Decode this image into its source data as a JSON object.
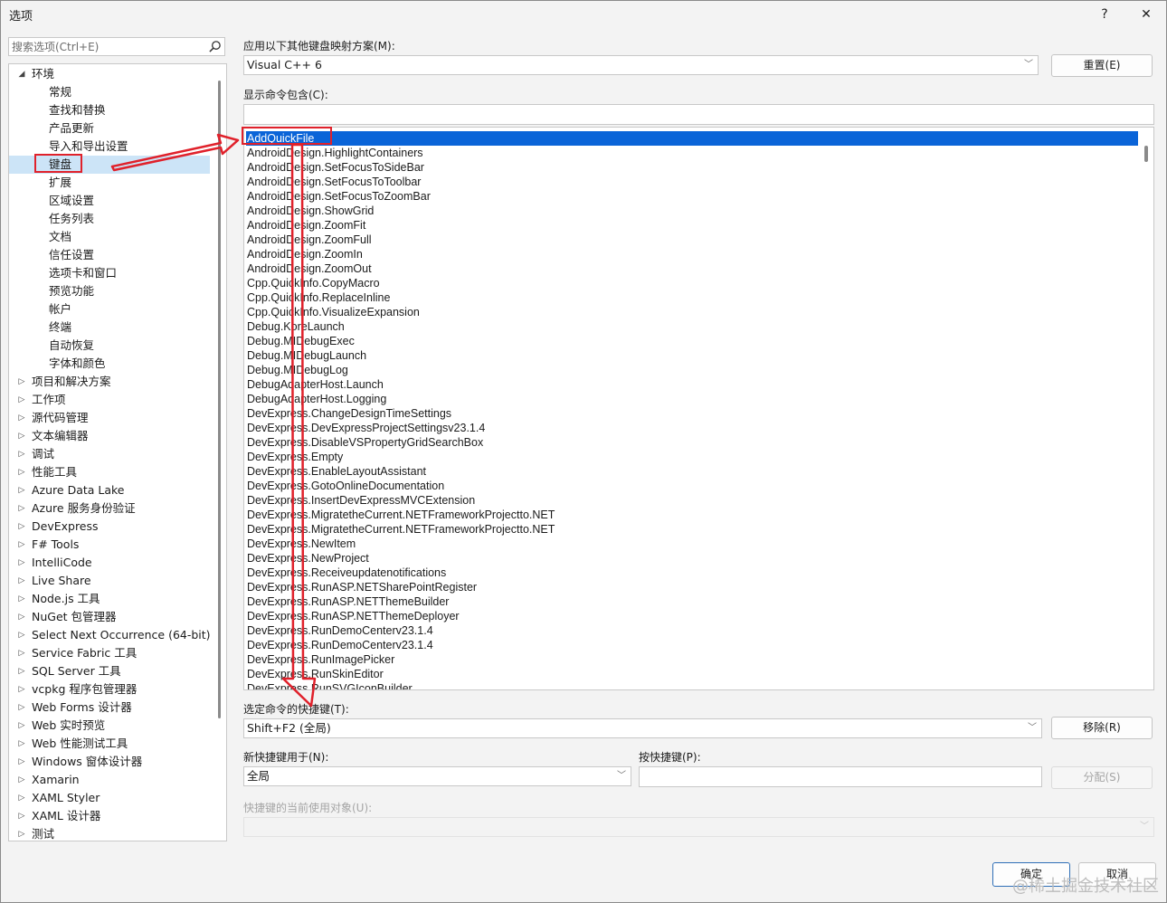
{
  "window": {
    "title": "选项",
    "help_label": "?",
    "close_label": "✕"
  },
  "search": {
    "placeholder": "搜索选项(Ctrl+E)"
  },
  "tree": {
    "items": [
      {
        "label": "环境",
        "arrow": "◢",
        "indent": 0
      },
      {
        "label": "常规",
        "arrow": "",
        "indent": 1
      },
      {
        "label": "查找和替换",
        "arrow": "",
        "indent": 1
      },
      {
        "label": "产品更新",
        "arrow": "",
        "indent": 1
      },
      {
        "label": "导入和导出设置",
        "arrow": "",
        "indent": 1
      },
      {
        "label": "键盘",
        "arrow": "",
        "indent": 1
      },
      {
        "label": "扩展",
        "arrow": "",
        "indent": 1
      },
      {
        "label": "区域设置",
        "arrow": "",
        "indent": 1
      },
      {
        "label": "任务列表",
        "arrow": "",
        "indent": 1
      },
      {
        "label": "文档",
        "arrow": "",
        "indent": 1
      },
      {
        "label": "信任设置",
        "arrow": "",
        "indent": 1
      },
      {
        "label": "选项卡和窗口",
        "arrow": "",
        "indent": 1
      },
      {
        "label": "预览功能",
        "arrow": "",
        "indent": 1
      },
      {
        "label": "帐户",
        "arrow": "",
        "indent": 1
      },
      {
        "label": "终端",
        "arrow": "",
        "indent": 1
      },
      {
        "label": "自动恢复",
        "arrow": "",
        "indent": 1
      },
      {
        "label": "字体和颜色",
        "arrow": "",
        "indent": 1
      },
      {
        "label": "项目和解决方案",
        "arrow": "▷",
        "indent": 0
      },
      {
        "label": "工作项",
        "arrow": "▷",
        "indent": 0
      },
      {
        "label": "源代码管理",
        "arrow": "▷",
        "indent": 0
      },
      {
        "label": "文本编辑器",
        "arrow": "▷",
        "indent": 0
      },
      {
        "label": "调试",
        "arrow": "▷",
        "indent": 0
      },
      {
        "label": "性能工具",
        "arrow": "▷",
        "indent": 0
      },
      {
        "label": "Azure Data Lake",
        "arrow": "▷",
        "indent": 0
      },
      {
        "label": "Azure 服务身份验证",
        "arrow": "▷",
        "indent": 0
      },
      {
        "label": "DevExpress",
        "arrow": "▷",
        "indent": 0
      },
      {
        "label": "F# Tools",
        "arrow": "▷",
        "indent": 0
      },
      {
        "label": "IntelliCode",
        "arrow": "▷",
        "indent": 0
      },
      {
        "label": "Live Share",
        "arrow": "▷",
        "indent": 0
      },
      {
        "label": "Node.js 工具",
        "arrow": "▷",
        "indent": 0
      },
      {
        "label": "NuGet 包管理器",
        "arrow": "▷",
        "indent": 0
      },
      {
        "label": "Select Next Occurrence (64-bit)",
        "arrow": "▷",
        "indent": 0
      },
      {
        "label": "Service Fabric 工具",
        "arrow": "▷",
        "indent": 0
      },
      {
        "label": "SQL Server 工具",
        "arrow": "▷",
        "indent": 0
      },
      {
        "label": "vcpkg 程序包管理器",
        "arrow": "▷",
        "indent": 0
      },
      {
        "label": "Web Forms 设计器",
        "arrow": "▷",
        "indent": 0
      },
      {
        "label": "Web 实时预览",
        "arrow": "▷",
        "indent": 0
      },
      {
        "label": "Web 性能测试工具",
        "arrow": "▷",
        "indent": 0
      },
      {
        "label": "Windows 窗体设计器",
        "arrow": "▷",
        "indent": 0
      },
      {
        "label": "Xamarin",
        "arrow": "▷",
        "indent": 0
      },
      {
        "label": "XAML Styler",
        "arrow": "▷",
        "indent": 0
      },
      {
        "label": "XAML 设计器",
        "arrow": "▷",
        "indent": 0
      },
      {
        "label": "测试",
        "arrow": "▷",
        "indent": 0
      }
    ],
    "selected_index": 5
  },
  "mapping": {
    "label": "应用以下其他键盘映射方案(M):",
    "value": "Visual C++ 6",
    "reset_label": "重置(E)"
  },
  "filter": {
    "label": "显示命令包含(C):",
    "value": ""
  },
  "commands": {
    "selected_index": 0,
    "items": [
      "AddQuickFile",
      "AndroidDesign.HighlightContainers",
      "AndroidDesign.SetFocusToSideBar",
      "AndroidDesign.SetFocusToToolbar",
      "AndroidDesign.SetFocusToZoomBar",
      "AndroidDesign.ShowGrid",
      "AndroidDesign.ZoomFit",
      "AndroidDesign.ZoomFull",
      "AndroidDesign.ZoomIn",
      "AndroidDesign.ZoomOut",
      "Cpp.QuickInfo.CopyMacro",
      "Cpp.QuickInfo.ReplaceInline",
      "Cpp.QuickInfo.VisualizeExpansion",
      "Debug.KoreLaunch",
      "Debug.MIDebugExec",
      "Debug.MIDebugLaunch",
      "Debug.MIDebugLog",
      "DebugAdapterHost.Launch",
      "DebugAdapterHost.Logging",
      "DevExpress.ChangeDesignTimeSettings",
      "DevExpress.DevExpressProjectSettingsv23.1.4",
      "DevExpress.DisableVSPropertyGridSearchBox",
      "DevExpress.Empty",
      "DevExpress.EnableLayoutAssistant",
      "DevExpress.GotoOnlineDocumentation",
      "DevExpress.InsertDevExpressMVCExtension",
      "DevExpress.MigratetheCurrent.NETFrameworkProjectto.NET",
      "DevExpress.MigratetheCurrent.NETFrameworkProjectto.NET",
      "DevExpress.NewItem",
      "DevExpress.NewProject",
      "DevExpress.Receiveupdatenotifications",
      "DevExpress.RunASP.NETSharePointRegister",
      "DevExpress.RunASP.NETThemeBuilder",
      "DevExpress.RunASP.NETThemeDeployer",
      "DevExpress.RunDemoCenterv23.1.4",
      "DevExpress.RunDemoCenterv23.1.4",
      "DevExpress.RunImagePicker",
      "DevExpress.RunSkinEditor",
      "DevExpress.RunSVGIconBuilder"
    ]
  },
  "shortcuts": {
    "label": "选定命令的快捷键(T):",
    "value": "Shift+F2 (全局)",
    "remove_label": "移除(R)"
  },
  "new_shortcut": {
    "scope_label": "新快捷键用于(N):",
    "scope_value": "全局",
    "press_label": "按快捷键(P):",
    "press_value": "",
    "assign_label": "分配(S)"
  },
  "current_use": {
    "label": "快捷键的当前使用对象(U):",
    "value": ""
  },
  "footer": {
    "ok_label": "确定",
    "cancel_label": "取消"
  },
  "watermark": "@稀土掘金技术社区",
  "colors": {
    "accent": "#0a64d8",
    "annotation": "#e0212b",
    "tree_selection": "#cce4f7"
  }
}
